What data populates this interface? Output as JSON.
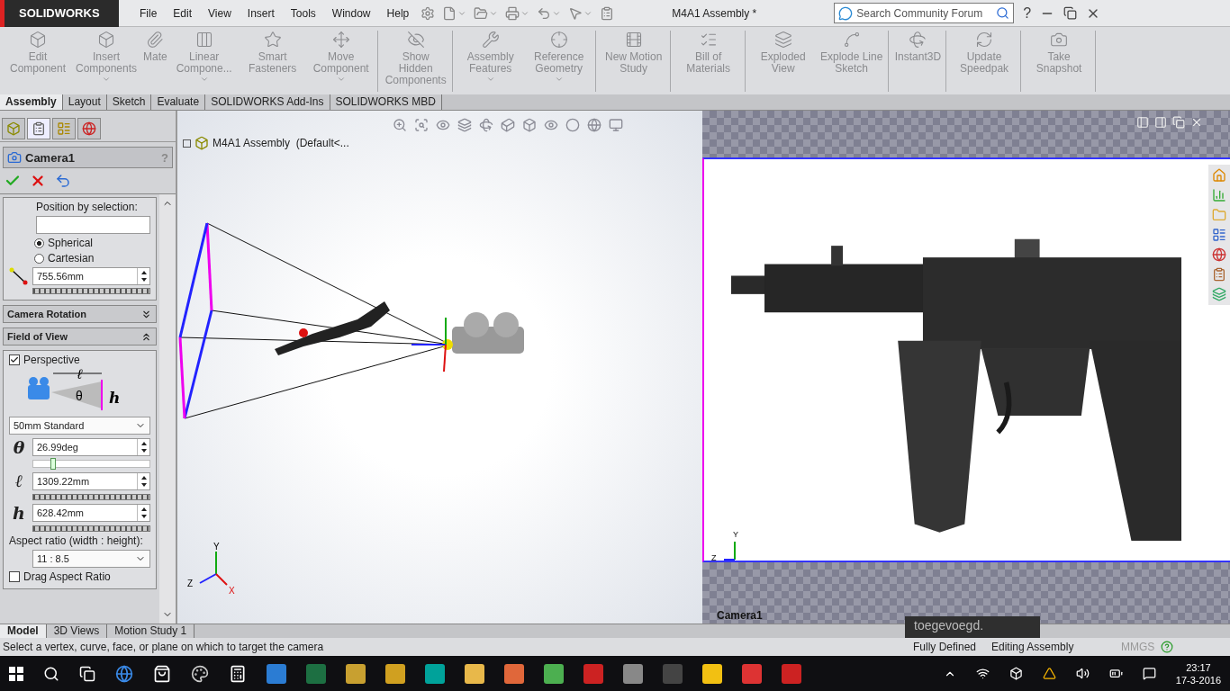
{
  "app": {
    "logo": "SOLIDWORKS"
  },
  "menu": [
    "File",
    "Edit",
    "View",
    "Insert",
    "Tools",
    "Window",
    "Help"
  ],
  "title": "M4A1 Assembly *",
  "search": {
    "placeholder": "Search Community Forum"
  },
  "help": "?",
  "ribbon": [
    {
      "items": [
        {
          "label": "Edit Component",
          "dropdown": false
        },
        {
          "label": "Insert Components",
          "dropdown": true
        },
        {
          "label": "Mate",
          "dropdown": false
        },
        {
          "label": "Linear Compone...",
          "dropdown": true
        },
        {
          "label": "Smart Fasteners",
          "dropdown": false
        },
        {
          "label": "Move Component",
          "dropdown": true
        }
      ]
    },
    {
      "items": [
        {
          "label": "Show Hidden Components",
          "dropdown": false
        }
      ]
    },
    {
      "items": [
        {
          "label": "Assembly Features",
          "dropdown": true
        },
        {
          "label": "Reference Geometry",
          "dropdown": true
        }
      ]
    },
    {
      "items": [
        {
          "label": "New Motion Study",
          "dropdown": false
        }
      ]
    },
    {
      "items": [
        {
          "label": "Bill of Materials",
          "dropdown": false
        }
      ]
    },
    {
      "items": [
        {
          "label": "Exploded View",
          "dropdown": false
        },
        {
          "label": "Explode Line Sketch",
          "dropdown": false
        }
      ]
    },
    {
      "items": [
        {
          "label": "Instant3D",
          "dropdown": false
        }
      ]
    },
    {
      "items": [
        {
          "label": "Update Speedpak",
          "dropdown": false
        }
      ]
    },
    {
      "items": [
        {
          "label": "Take Snapshot",
          "dropdown": false
        }
      ]
    }
  ],
  "tabs": [
    {
      "label": "Assembly",
      "selected": true
    },
    {
      "label": "Layout",
      "selected": false
    },
    {
      "label": "Sketch",
      "selected": false
    },
    {
      "label": "Evaluate",
      "selected": false
    },
    {
      "label": "SOLIDWORKS Add-Ins",
      "selected": false
    },
    {
      "label": "SOLIDWORKS MBD",
      "selected": false
    }
  ],
  "manager_tabs": [
    {
      "selected": false
    },
    {
      "selected": true
    },
    {
      "selected": false
    },
    {
      "selected": false
    }
  ],
  "property_manager": {
    "title": "Camera1",
    "help": "?",
    "position_label": "Position by selection:",
    "radios": [
      {
        "label": "Spherical",
        "selected": true
      },
      {
        "label": "Cartesian",
        "selected": false
      }
    ],
    "distance": "755.56mm",
    "sections": [
      {
        "title": "Camera Rotation",
        "expanded": false
      },
      {
        "title": "Field of View",
        "expanded": true
      }
    ],
    "perspective": {
      "label": "Perspective",
      "checked": true
    },
    "diagram_labels": [
      "ℓ",
      "θ",
      "h"
    ],
    "lens": "50mm Standard",
    "fields": [
      {
        "symbol": "θ",
        "value": "26.99deg",
        "kind": "slider",
        "level": 0.15
      },
      {
        "symbol": "ℓ",
        "value": "1309.22mm",
        "kind": "ruler"
      },
      {
        "symbol": "h",
        "value": "628.42mm",
        "kind": "ruler"
      }
    ],
    "aspect_label": "Aspect ratio (width : height):",
    "aspect": "11 : 8.5",
    "drag": {
      "label": "Drag Aspect Ratio",
      "checked": false
    }
  },
  "tree": {
    "label": "M4A1 Assembly  (Default<..."
  },
  "triad": [
    "Y",
    "Z",
    "X"
  ],
  "camera_view": {
    "label": "Camera1",
    "triad": [
      "Y",
      "Z"
    ],
    "notice": "toegevoegd."
  },
  "bottom_tabs": [
    {
      "label": "Model",
      "selected": true
    },
    {
      "label": "3D Views",
      "selected": false
    },
    {
      "label": "Motion Study 1",
      "selected": false
    }
  ],
  "status": {
    "message": "Select a vertex, curve, face, or plane on which to target the camera",
    "state": "Fully Defined",
    "mode": "Editing Assembly",
    "units": "MMGS"
  },
  "clock": {
    "time": "23:17",
    "date": "17-3-2016"
  }
}
